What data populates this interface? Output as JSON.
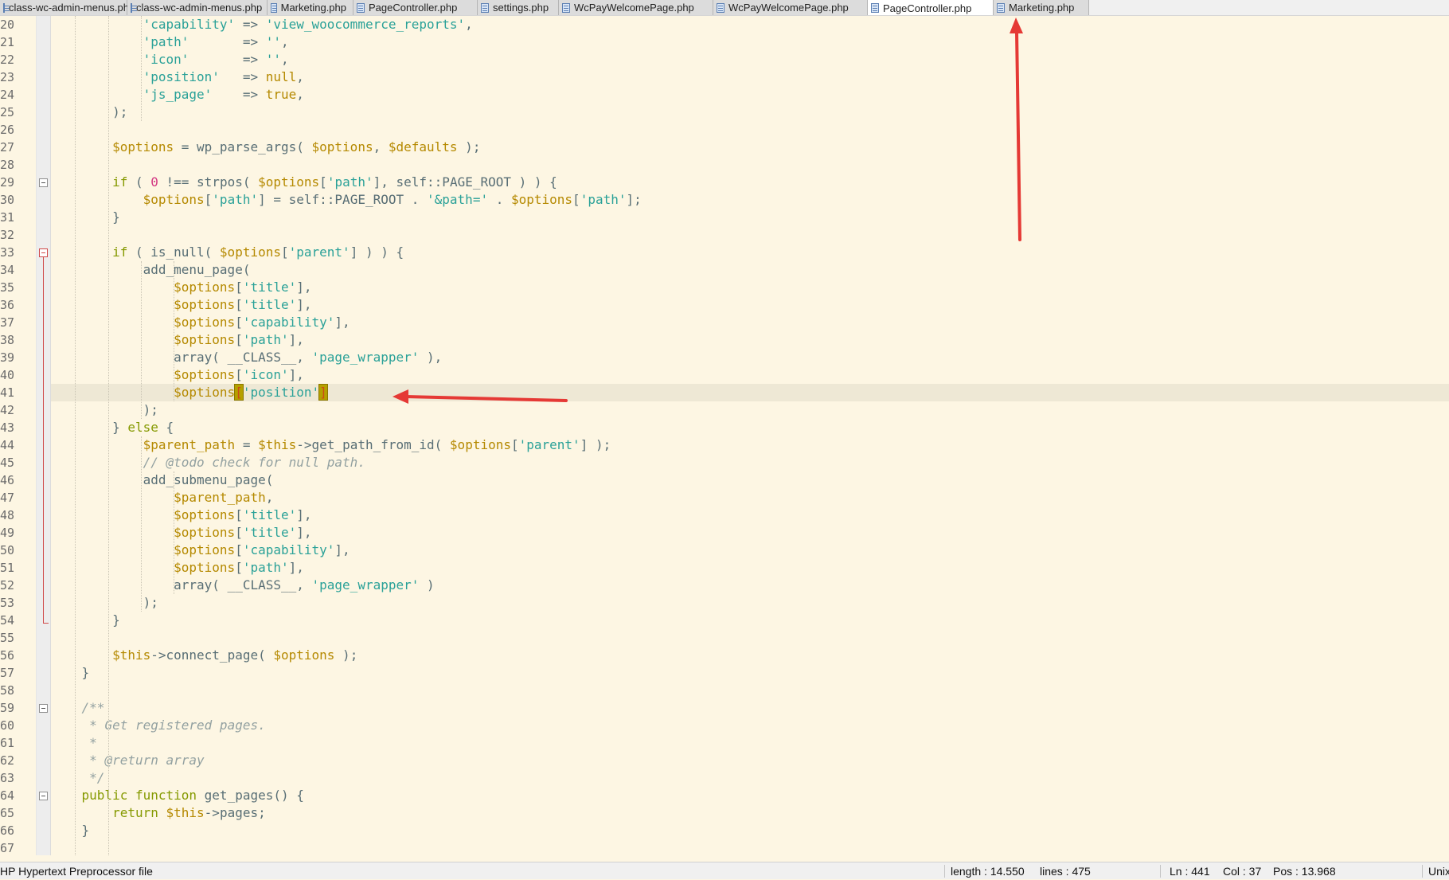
{
  "tabs": [
    {
      "label": "class-wc-admin-menus.php",
      "active": false
    },
    {
      "label": "class-wc-admin-menus.php",
      "active": false
    },
    {
      "label": "Marketing.php",
      "active": false
    },
    {
      "label": "PageController.php",
      "active": false
    },
    {
      "label": "settings.php",
      "active": false
    },
    {
      "label": "WcPayWelcomePage.php",
      "active": false
    },
    {
      "label": "WcPayWelcomePage.php",
      "active": false
    },
    {
      "label": "PageController.php",
      "active": true
    },
    {
      "label": "Marketing.php",
      "active": false
    }
  ],
  "editor": {
    "line_numbers": [
      "20",
      "21",
      "22",
      "23",
      "24",
      "25",
      "26",
      "27",
      "28",
      "29",
      "30",
      "31",
      "32",
      "33",
      "34",
      "35",
      "36",
      "37",
      "38",
      "39",
      "40",
      "41",
      "42",
      "43",
      "44",
      "45",
      "46",
      "47",
      "48",
      "49",
      "50",
      "51",
      "52",
      "53",
      "54",
      "55",
      "56",
      "57",
      "58",
      "59",
      "60",
      "61",
      "62",
      "63",
      "64",
      "65",
      "66",
      "67"
    ],
    "current_line_index": 21,
    "fold_marker_rows": [
      9,
      13,
      39,
      44
    ],
    "code_lines": [
      [
        {
          "t": "            ",
          "c": ""
        },
        {
          "t": "'capability'",
          "c": "str"
        },
        {
          "t": " => ",
          "c": "op"
        },
        {
          "t": "'view_woocommerce_reports'",
          "c": "str"
        },
        {
          "t": ",",
          "c": "op"
        }
      ],
      [
        {
          "t": "            ",
          "c": ""
        },
        {
          "t": "'path'",
          "c": "str"
        },
        {
          "t": "       => ",
          "c": "op"
        },
        {
          "t": "''",
          "c": "str"
        },
        {
          "t": ",",
          "c": "op"
        }
      ],
      [
        {
          "t": "            ",
          "c": ""
        },
        {
          "t": "'icon'",
          "c": "str"
        },
        {
          "t": "       => ",
          "c": "op"
        },
        {
          "t": "''",
          "c": "str"
        },
        {
          "t": ",",
          "c": "op"
        }
      ],
      [
        {
          "t": "            ",
          "c": ""
        },
        {
          "t": "'position'",
          "c": "str"
        },
        {
          "t": "   => ",
          "c": "op"
        },
        {
          "t": "null",
          "c": "var"
        },
        {
          "t": ",",
          "c": "op"
        }
      ],
      [
        {
          "t": "            ",
          "c": ""
        },
        {
          "t": "'js_page'",
          "c": "str"
        },
        {
          "t": "    => ",
          "c": "op"
        },
        {
          "t": "true",
          "c": "var"
        },
        {
          "t": ",",
          "c": "op"
        }
      ],
      [
        {
          "t": "        );",
          "c": "op"
        }
      ],
      [],
      [
        {
          "t": "        ",
          "c": ""
        },
        {
          "t": "$options",
          "c": "var"
        },
        {
          "t": " = wp_parse_args( ",
          "c": "op"
        },
        {
          "t": "$options",
          "c": "var"
        },
        {
          "t": ", ",
          "c": "op"
        },
        {
          "t": "$defaults",
          "c": "var"
        },
        {
          "t": " );",
          "c": "op"
        }
      ],
      [],
      [
        {
          "t": "        ",
          "c": ""
        },
        {
          "t": "if",
          "c": "kw"
        },
        {
          "t": " ( ",
          "c": "op"
        },
        {
          "t": "0",
          "c": "num"
        },
        {
          "t": " !== strpos( ",
          "c": "op"
        },
        {
          "t": "$options",
          "c": "var"
        },
        {
          "t": "[",
          "c": "op"
        },
        {
          "t": "'path'",
          "c": "str"
        },
        {
          "t": "], self::PAGE_ROOT ) ) {",
          "c": "op"
        }
      ],
      [
        {
          "t": "            ",
          "c": ""
        },
        {
          "t": "$options",
          "c": "var"
        },
        {
          "t": "[",
          "c": "op"
        },
        {
          "t": "'path'",
          "c": "str"
        },
        {
          "t": "] = self::PAGE_ROOT . ",
          "c": "op"
        },
        {
          "t": "'&path='",
          "c": "str"
        },
        {
          "t": " . ",
          "c": "op"
        },
        {
          "t": "$options",
          "c": "var"
        },
        {
          "t": "[",
          "c": "op"
        },
        {
          "t": "'path'",
          "c": "str"
        },
        {
          "t": "];",
          "c": "op"
        }
      ],
      [
        {
          "t": "        }",
          "c": "op"
        }
      ],
      [],
      [
        {
          "t": "        ",
          "c": ""
        },
        {
          "t": "if",
          "c": "kw"
        },
        {
          "t": " ( is_null( ",
          "c": "op"
        },
        {
          "t": "$options",
          "c": "var"
        },
        {
          "t": "[",
          "c": "op"
        },
        {
          "t": "'parent'",
          "c": "str"
        },
        {
          "t": "] ) ) {",
          "c": "op"
        }
      ],
      [
        {
          "t": "            add_menu_page(",
          "c": "op"
        }
      ],
      [
        {
          "t": "                ",
          "c": ""
        },
        {
          "t": "$options",
          "c": "var"
        },
        {
          "t": "[",
          "c": "op"
        },
        {
          "t": "'title'",
          "c": "str"
        },
        {
          "t": "],",
          "c": "op"
        }
      ],
      [
        {
          "t": "                ",
          "c": ""
        },
        {
          "t": "$options",
          "c": "var"
        },
        {
          "t": "[",
          "c": "op"
        },
        {
          "t": "'title'",
          "c": "str"
        },
        {
          "t": "],",
          "c": "op"
        }
      ],
      [
        {
          "t": "                ",
          "c": ""
        },
        {
          "t": "$options",
          "c": "var"
        },
        {
          "t": "[",
          "c": "op"
        },
        {
          "t": "'capability'",
          "c": "str"
        },
        {
          "t": "],",
          "c": "op"
        }
      ],
      [
        {
          "t": "                ",
          "c": ""
        },
        {
          "t": "$options",
          "c": "var"
        },
        {
          "t": "[",
          "c": "op"
        },
        {
          "t": "'path'",
          "c": "str"
        },
        {
          "t": "],",
          "c": "op"
        }
      ],
      [
        {
          "t": "                array( __CLASS__, ",
          "c": "op"
        },
        {
          "t": "'page_wrapper'",
          "c": "str"
        },
        {
          "t": " ),",
          "c": "op"
        }
      ],
      [
        {
          "t": "                ",
          "c": ""
        },
        {
          "t": "$options",
          "c": "var"
        },
        {
          "t": "[",
          "c": "op"
        },
        {
          "t": "'icon'",
          "c": "str"
        },
        {
          "t": "],",
          "c": "op"
        }
      ],
      [
        {
          "t": "                ",
          "c": ""
        },
        {
          "t": "$options",
          "c": "var"
        },
        {
          "t": "[",
          "c": "brk"
        },
        {
          "t": "'position'",
          "c": "str"
        },
        {
          "t": "]",
          "c": "brk"
        }
      ],
      [
        {
          "t": "            );",
          "c": "op"
        }
      ],
      [
        {
          "t": "        } ",
          "c": "op"
        },
        {
          "t": "else",
          "c": "kw"
        },
        {
          "t": " {",
          "c": "op"
        }
      ],
      [
        {
          "t": "            ",
          "c": ""
        },
        {
          "t": "$parent_path",
          "c": "var"
        },
        {
          "t": " = ",
          "c": "op"
        },
        {
          "t": "$this",
          "c": "var"
        },
        {
          "t": "->get_path_from_id( ",
          "c": "op"
        },
        {
          "t": "$options",
          "c": "var"
        },
        {
          "t": "[",
          "c": "op"
        },
        {
          "t": "'parent'",
          "c": "str"
        },
        {
          "t": "] );",
          "c": "op"
        }
      ],
      [
        {
          "t": "            ",
          "c": ""
        },
        {
          "t": "// @todo check for null path.",
          "c": "com"
        }
      ],
      [
        {
          "t": "            add_submenu_page(",
          "c": "op"
        }
      ],
      [
        {
          "t": "                ",
          "c": ""
        },
        {
          "t": "$parent_path",
          "c": "var"
        },
        {
          "t": ",",
          "c": "op"
        }
      ],
      [
        {
          "t": "                ",
          "c": ""
        },
        {
          "t": "$options",
          "c": "var"
        },
        {
          "t": "[",
          "c": "op"
        },
        {
          "t": "'title'",
          "c": "str"
        },
        {
          "t": "],",
          "c": "op"
        }
      ],
      [
        {
          "t": "                ",
          "c": ""
        },
        {
          "t": "$options",
          "c": "var"
        },
        {
          "t": "[",
          "c": "op"
        },
        {
          "t": "'title'",
          "c": "str"
        },
        {
          "t": "],",
          "c": "op"
        }
      ],
      [
        {
          "t": "                ",
          "c": ""
        },
        {
          "t": "$options",
          "c": "var"
        },
        {
          "t": "[",
          "c": "op"
        },
        {
          "t": "'capability'",
          "c": "str"
        },
        {
          "t": "],",
          "c": "op"
        }
      ],
      [
        {
          "t": "                ",
          "c": ""
        },
        {
          "t": "$options",
          "c": "var"
        },
        {
          "t": "[",
          "c": "op"
        },
        {
          "t": "'path'",
          "c": "str"
        },
        {
          "t": "],",
          "c": "op"
        }
      ],
      [
        {
          "t": "                array( __CLASS__, ",
          "c": "op"
        },
        {
          "t": "'page_wrapper'",
          "c": "str"
        },
        {
          "t": " )",
          "c": "op"
        }
      ],
      [
        {
          "t": "            );",
          "c": "op"
        }
      ],
      [
        {
          "t": "        }",
          "c": "op"
        }
      ],
      [],
      [
        {
          "t": "        ",
          "c": ""
        },
        {
          "t": "$this",
          "c": "var"
        },
        {
          "t": "->connect_page( ",
          "c": "op"
        },
        {
          "t": "$options",
          "c": "var"
        },
        {
          "t": " );",
          "c": "op"
        }
      ],
      [
        {
          "t": "    }",
          "c": "op"
        }
      ],
      [],
      [
        {
          "t": "    ",
          "c": ""
        },
        {
          "t": "/**",
          "c": "com"
        }
      ],
      [
        {
          "t": "     ",
          "c": ""
        },
        {
          "t": "* Get registered pages.",
          "c": "com"
        }
      ],
      [
        {
          "t": "     ",
          "c": ""
        },
        {
          "t": "*",
          "c": "com"
        }
      ],
      [
        {
          "t": "     ",
          "c": ""
        },
        {
          "t": "* @return array",
          "c": "com"
        }
      ],
      [
        {
          "t": "     ",
          "c": ""
        },
        {
          "t": "*/",
          "c": "com"
        }
      ],
      [
        {
          "t": "    ",
          "c": ""
        },
        {
          "t": "public function",
          "c": "kw"
        },
        {
          "t": " get_pages() {",
          "c": "op"
        }
      ],
      [
        {
          "t": "        ",
          "c": ""
        },
        {
          "t": "return",
          "c": "kw"
        },
        {
          "t": " ",
          "c": ""
        },
        {
          "t": "$this",
          "c": "var"
        },
        {
          "t": "->pages;",
          "c": "op"
        }
      ],
      [
        {
          "t": "    }",
          "c": "op"
        }
      ],
      []
    ]
  },
  "statusbar": {
    "file_type": "HP Hypertext Preprocessor file",
    "length": "length : 14.550",
    "lines": "lines : 475",
    "ln": "Ln : 441",
    "col": "Col : 37",
    "pos": "Pos : 13.968",
    "eol": "Unix"
  },
  "annotation_color": "#e53935"
}
